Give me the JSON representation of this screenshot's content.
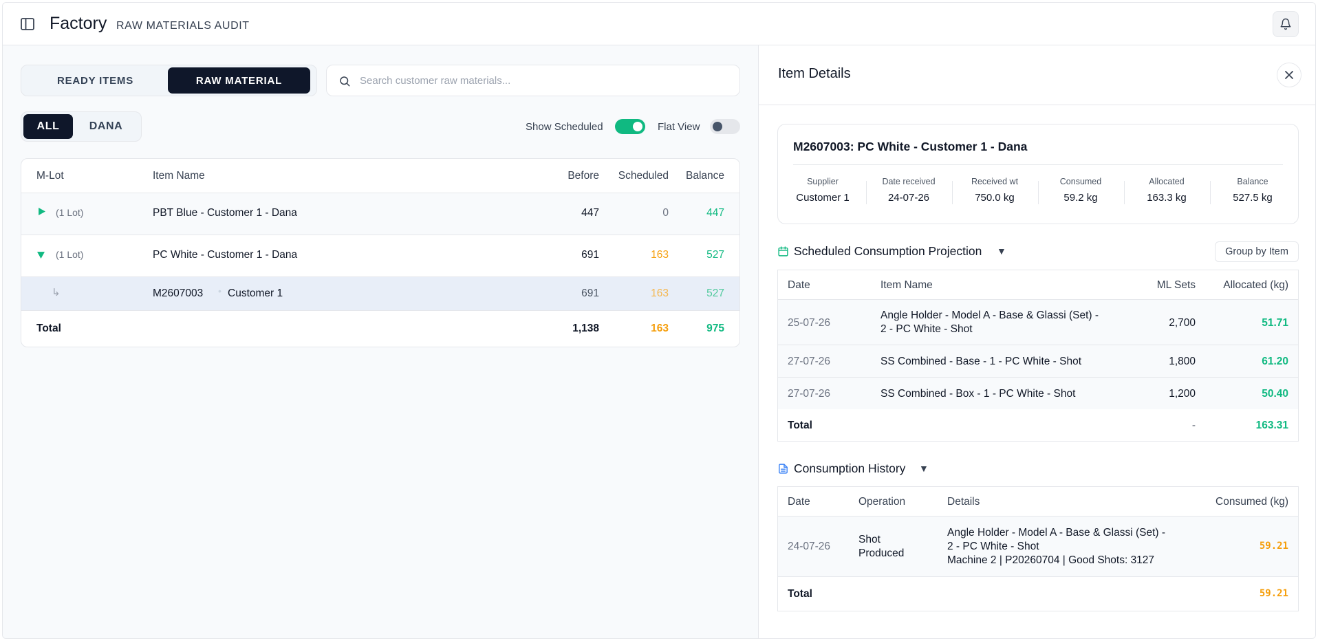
{
  "header": {
    "title": "Factory",
    "subtitle": "RAW MATERIALS AUDIT"
  },
  "tabs": {
    "ready_items": "READY ITEMS",
    "raw_material": "RAW MATERIAL",
    "active": "RAW MATERIAL"
  },
  "search": {
    "placeholder": "Search customer raw materials...",
    "value": ""
  },
  "filters": {
    "all": "ALL",
    "dana": "DANA",
    "active": "ALL"
  },
  "toggles": {
    "show_scheduled": {
      "label": "Show Scheduled",
      "on": true
    },
    "flat_view": {
      "label": "Flat View",
      "on": false
    }
  },
  "main_table": {
    "columns": {
      "m_lot": "M-Lot",
      "item_name": "Item Name",
      "before": "Before",
      "scheduled": "Scheduled",
      "balance": "Balance"
    },
    "rows": [
      {
        "lot": "(1 Lot)",
        "item_name": "PBT Blue - Customer 1 - Dana",
        "before": "447",
        "scheduled": "0",
        "balance": "447",
        "expanded": false
      },
      {
        "lot": "(1 Lot)",
        "item_name": "PC White - Customer 1 - Dana",
        "before": "691",
        "scheduled": "163",
        "balance": "527",
        "expanded": true
      }
    ],
    "child_row": {
      "lot_code": "M2607003",
      "customer": "Customer 1",
      "before": "691",
      "scheduled": "163",
      "balance": "527"
    },
    "total": {
      "label": "Total",
      "before": "1,138",
      "scheduled": "163",
      "balance": "975"
    }
  },
  "details": {
    "title": "Item Details",
    "card": {
      "code": "M2607003:",
      "name": "PC White - Customer 1 - Dana",
      "stats": [
        {
          "label": "Supplier",
          "value": "Customer 1"
        },
        {
          "label": "Date received",
          "value": "24-07-26"
        },
        {
          "label": "Received wt",
          "value": "750.0 kg"
        },
        {
          "label": "Consumed",
          "value": "59.2 kg"
        },
        {
          "label": "Allocated",
          "value": "163.3 kg"
        },
        {
          "label": "Balance",
          "value": "527.5 kg"
        }
      ]
    },
    "projection": {
      "title": "Scheduled Consumption Projection",
      "group_button": "Group by Item",
      "columns": {
        "date": "Date",
        "item_name": "Item Name",
        "ml_sets": "ML Sets",
        "allocated": "Allocated (kg)"
      },
      "rows": [
        {
          "date": "25-07-26",
          "item_name_1": "Angle Holder - Model A - Base & Glassi (Set) -",
          "item_name_2": "2 - PC White - Shot",
          "ml_sets": "2,700",
          "allocated": "51.71"
        },
        {
          "date": "27-07-26",
          "item_name_1": "SS Combined - Base - 1 - PC White - Shot",
          "item_name_2": "",
          "ml_sets": "1,800",
          "allocated": "61.20"
        },
        {
          "date": "27-07-26",
          "item_name_1": "SS Combined - Box - 1 - PC White - Shot",
          "item_name_2": "",
          "ml_sets": "1,200",
          "allocated": "50.40"
        }
      ],
      "total": {
        "label": "Total",
        "ml_sets": "-",
        "allocated": "163.31"
      }
    },
    "history": {
      "title": "Consumption History",
      "columns": {
        "date": "Date",
        "operation": "Operation",
        "details": "Details",
        "consumed": "Consumed (kg)"
      },
      "rows": [
        {
          "date": "24-07-26",
          "operation_1": "Shot",
          "operation_2": "Produced",
          "details_1": "Angle Holder - Model A - Base & Glassi (Set) -",
          "details_2": "2 - PC White - Shot",
          "details_3": "Machine 2 | P20260704 | Good Shots: 3127",
          "consumed": "59.21"
        }
      ],
      "total": {
        "label": "Total",
        "consumed": "59.21"
      }
    }
  },
  "colors": {
    "accent_dark": "#0f172a",
    "success": "#10b981",
    "warning": "#f59e0b",
    "selected_row": "#e8eef8"
  },
  "icons": {
    "sidebar": "sidebar-toggle-icon",
    "bell": "bell-icon",
    "search": "search-icon",
    "close": "close-icon",
    "calendar": "calendar-icon",
    "document": "document-icon"
  }
}
